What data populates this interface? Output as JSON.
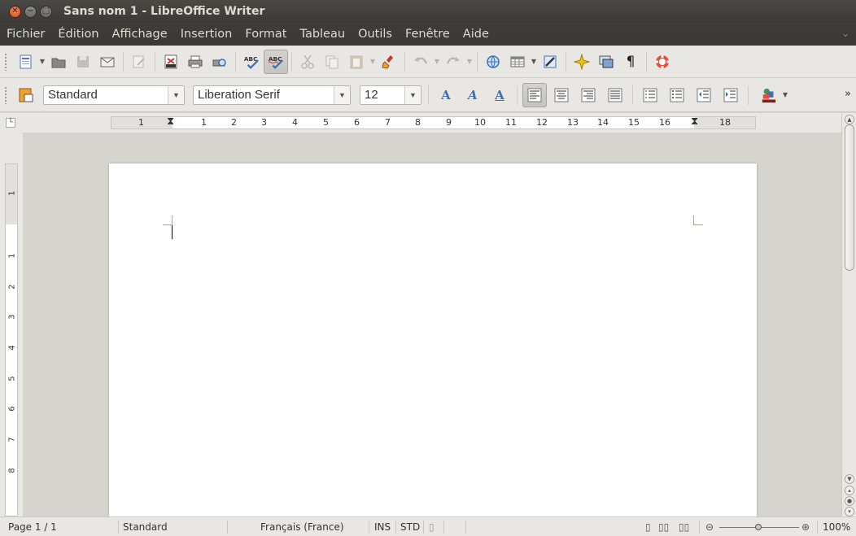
{
  "window": {
    "title": "Sans nom 1 - LibreOffice Writer"
  },
  "menu": [
    "Fichier",
    "Édition",
    "Affichage",
    "Insertion",
    "Format",
    "Tableau",
    "Outils",
    "Fenêtre",
    "Aide"
  ],
  "formatting": {
    "paragraph_style": "Standard",
    "font_name": "Liberation Serif",
    "font_size": "12"
  },
  "ruler": {
    "h_numbers": [
      "1",
      "1",
      "2",
      "3",
      "4",
      "5",
      "6",
      "7",
      "8",
      "9",
      "10",
      "11",
      "12",
      "13",
      "14",
      "15",
      "16",
      "17",
      "18"
    ],
    "v_numbers": [
      "1",
      "1",
      "2",
      "3",
      "4",
      "5",
      "6",
      "7",
      "8"
    ]
  },
  "statusbar": {
    "page": "Page 1 / 1",
    "style": "Standard",
    "language": "Français (France)",
    "insert_mode": "INS",
    "selection_mode": "STD",
    "zoom": "100%"
  },
  "colors": {
    "titlebar": "#3c3b37",
    "accent_close": "#dd4814",
    "toolbar_bg": "#e9e7e3"
  }
}
